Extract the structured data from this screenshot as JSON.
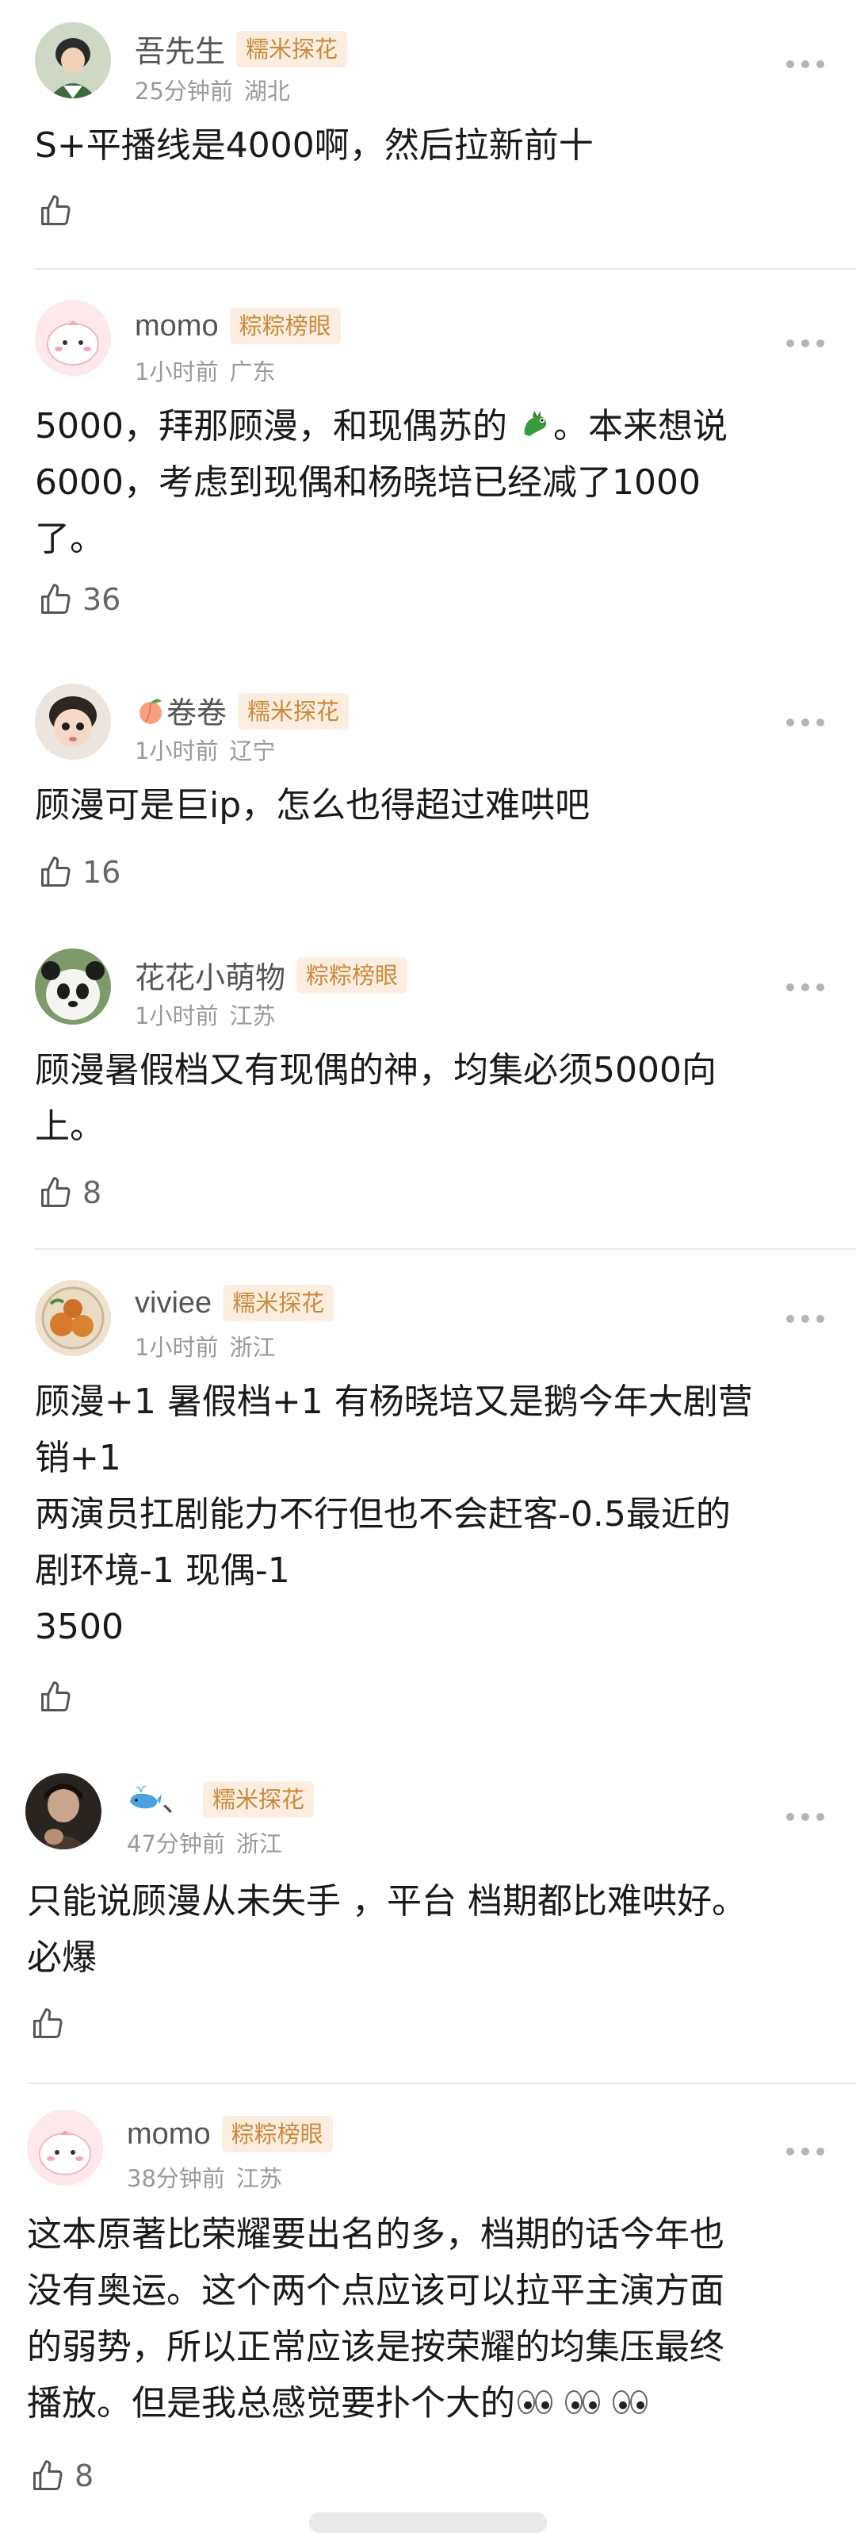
{
  "comments": [
    {
      "username": "吾先生",
      "badge": "糯米探花",
      "time": "25分钟前",
      "location": "湖北",
      "lines": [
        "S+平播线是4000啊，然后拉新前十"
      ],
      "likes": ""
    },
    {
      "username": "momo",
      "badge": "粽粽榜眼",
      "time": "1小时前",
      "location": "广东",
      "lines": [
        "5000，拜那顾漫，和现偶苏的",
        "。本来想说",
        "6000，考虑到现偶和杨晓培已经减了1000",
        "了。"
      ],
      "likes": "36"
    },
    {
      "username": "卷卷",
      "badge": "糯米探花",
      "time": "1小时前",
      "location": "辽宁",
      "lines": [
        "顾漫可是巨ip，怎么也得超过难哄吧"
      ],
      "likes": "16"
    },
    {
      "username": "花花小萌物",
      "badge": "粽粽榜眼",
      "time": "1小时前",
      "location": "江苏",
      "lines": [
        "顾漫暑假档又有现偶的神，均集必须5000向",
        "上。"
      ],
      "likes": "8"
    },
    {
      "username": "viviee",
      "badge": "糯米探花",
      "time": "1小时前",
      "location": "浙江",
      "lines": [
        "顾漫+1 暑假档+1 有杨晓培又是鹅今年大剧营",
        "销+1",
        "两演员扛剧能力不行但也不会赶客-0.5最近的",
        "剧环境-1 现偶-1",
        "3500"
      ],
      "likes": ""
    },
    {
      "username": "、",
      "badge": "糯米探花",
      "time": "47分钟前",
      "location": "浙江",
      "lines": [
        "只能说顾漫从未失手 ，平台 档期都比难哄好。",
        "必爆"
      ],
      "likes": ""
    },
    {
      "username": "momo",
      "badge": "粽粽榜眼",
      "time": "38分钟前",
      "location": "江苏",
      "lines": [
        "这本原著比荣耀要出名的多，档期的话今年也",
        "没有奥运。这个两个点应该可以拉平主演方面",
        "的弱势，所以正常应该是按荣耀的均集压最终",
        "播放。但是我总感觉要扑个大的"
      ],
      "likes": "8"
    }
  ]
}
